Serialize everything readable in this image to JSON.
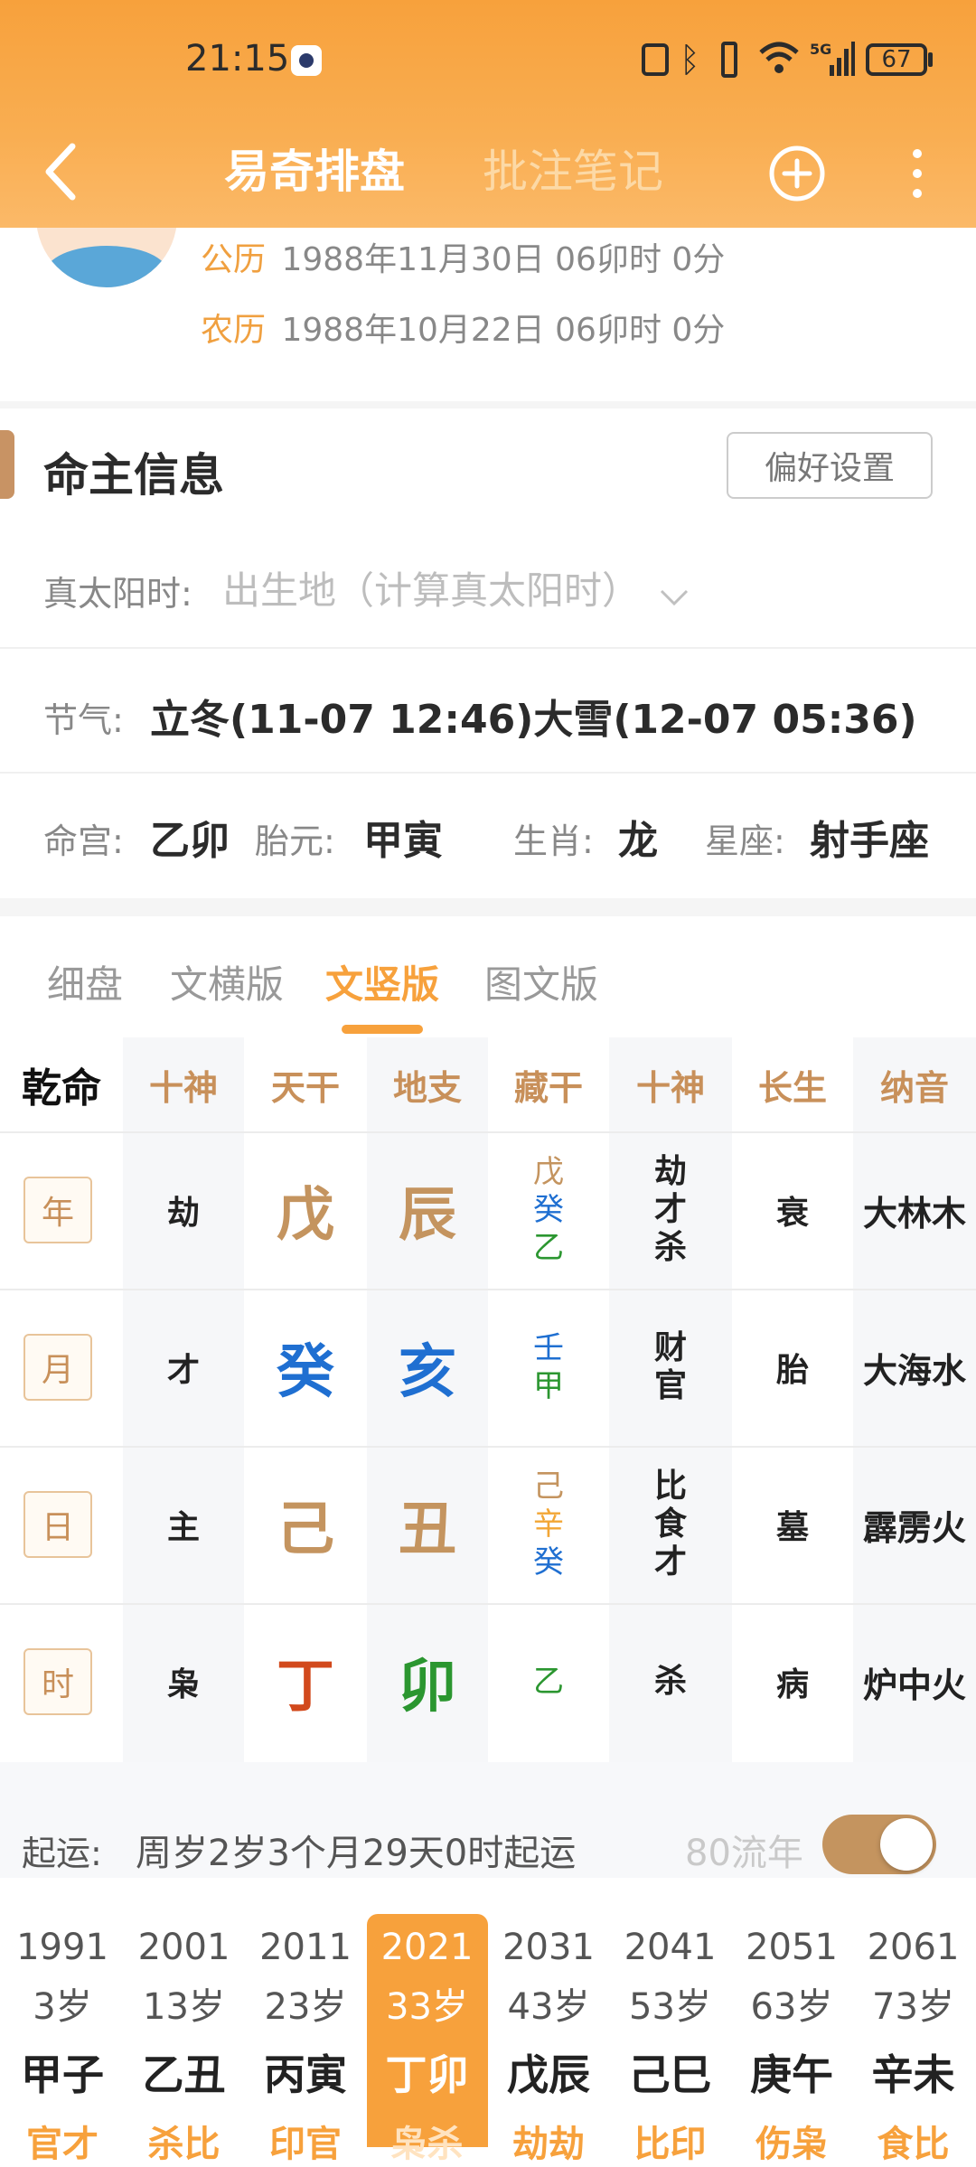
{
  "status_bar": {
    "time": "21:15",
    "battery": "67"
  },
  "header": {
    "title": "易奇排盘",
    "tab2": "批注笔记"
  },
  "profile": {
    "solar_label": "公历",
    "solar_value": "1988年11月30日 06卯时 0分",
    "lunar_label": "农历",
    "lunar_value": "1988年10月22日 06卯时 0分"
  },
  "info": {
    "section_title": "命主信息",
    "pref_button": "偏好设置",
    "true_sun_label": "真太阳时:",
    "true_sun_placeholder": "出生地（计算真太阳时）",
    "jieqi_label": "节气:",
    "jieqi_value": "立冬(11-07 12:46)大雪(12-07 05:36)",
    "minggong_label": "命宫:",
    "minggong_value": "乙卯",
    "taiyuan_label": "胎元:",
    "taiyuan_value": "甲寅",
    "shengxiao_label": "生肖:",
    "shengxiao_value": "龙",
    "xingzuo_label": "星座:",
    "xingzuo_value": "射手座"
  },
  "view_tabs": [
    "细盘",
    "文横版",
    "文竖版",
    "图文版"
  ],
  "active_view_tab": "文竖版",
  "chart": {
    "corner": "乾命",
    "headers": [
      "十神",
      "天干",
      "地支",
      "藏干",
      "十神",
      "长生",
      "纳音"
    ],
    "rows": [
      {
        "pillar": "年",
        "shishen": "劫",
        "tiangan": "戊",
        "dizhi": "辰",
        "canggan": [
          "戊",
          "癸",
          "乙"
        ],
        "shishen2": [
          "劫",
          "才",
          "杀"
        ],
        "changsheng": "衰",
        "nayin": "大林木"
      },
      {
        "pillar": "月",
        "shishen": "才",
        "tiangan": "癸",
        "dizhi": "亥",
        "canggan": [
          "壬",
          "甲"
        ],
        "shishen2": [
          "财",
          "官"
        ],
        "changsheng": "胎",
        "nayin": "大海水"
      },
      {
        "pillar": "日",
        "shishen": "主",
        "tiangan": "己",
        "dizhi": "丑",
        "canggan": [
          "己",
          "辛",
          "癸"
        ],
        "shishen2": [
          "比",
          "食",
          "才"
        ],
        "changsheng": "墓",
        "nayin": "霹雳火"
      },
      {
        "pillar": "时",
        "shishen": "枭",
        "tiangan": "丁",
        "dizhi": "卯",
        "canggan": [
          "乙"
        ],
        "shishen2": [
          "杀"
        ],
        "changsheng": "病",
        "nayin": "炉中火"
      }
    ]
  },
  "qiyun": {
    "label": "起运:",
    "value": "周岁2岁3个月29天0时起运",
    "toggle_label": "80流年",
    "toggle_on": true
  },
  "dayun": [
    {
      "year": "1991",
      "age": "3岁",
      "ganzhi": "甲子",
      "shishen": "官才"
    },
    {
      "year": "2001",
      "age": "13岁",
      "ganzhi": "乙丑",
      "shishen": "杀比"
    },
    {
      "year": "2011",
      "age": "23岁",
      "ganzhi": "丙寅",
      "shishen": "印官"
    },
    {
      "year": "2021",
      "age": "33岁",
      "ganzhi": "丁卯",
      "shishen": "枭杀"
    },
    {
      "year": "2031",
      "age": "43岁",
      "ganzhi": "戊辰",
      "shishen": "劫劫"
    },
    {
      "year": "2041",
      "age": "53岁",
      "ganzhi": "己巳",
      "shishen": "比印"
    },
    {
      "year": "2051",
      "age": "63岁",
      "ganzhi": "庚午",
      "shishen": "伤枭"
    },
    {
      "year": "2061",
      "age": "73岁",
      "ganzhi": "辛未",
      "shishen": "食比"
    }
  ],
  "active_dayun": "2021",
  "colors": {
    "accent": "#f7a13c",
    "earth": "#c4945f",
    "water": "#1f6fd1",
    "wood": "#2b9630",
    "fire": "#d2491c",
    "metal": "#f2a635"
  }
}
